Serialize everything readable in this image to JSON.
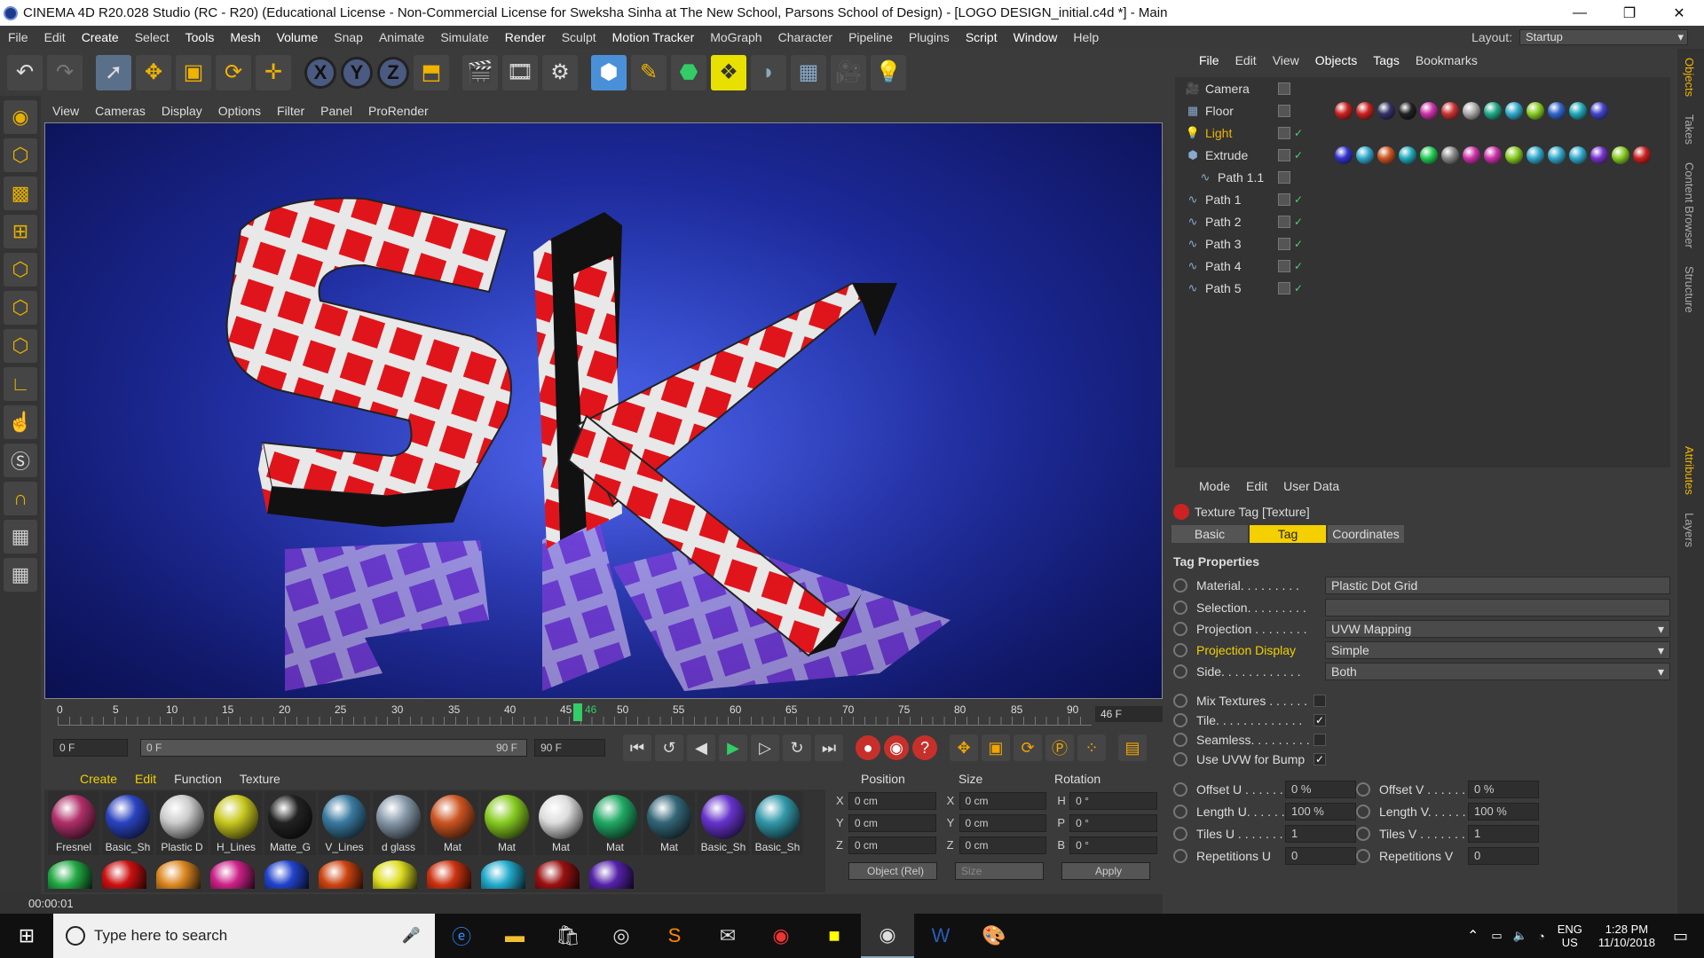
{
  "titlebar": {
    "title": "CINEMA 4D R20.028 Studio (RC - R20) (Educational License - Non-Commercial License for Sweksha Sinha at The New School, Parsons School of Design) - [LOGO DESIGN_initial.c4d *] - Main",
    "minimize": "—",
    "restore": "❐",
    "close": "✕"
  },
  "menubar": {
    "items": [
      "File",
      "Edit",
      "Create",
      "Select",
      "Tools",
      "Mesh",
      "Volume",
      "Snap",
      "Animate",
      "Simulate",
      "Render",
      "Sculpt",
      "Motion Tracker",
      "MoGraph",
      "Character",
      "Pipeline",
      "Plugins",
      "Script",
      "Window",
      "Help"
    ],
    "layout_label": "Layout:",
    "layout_value": "Startup"
  },
  "toolbar": {
    "icons": [
      "undo-icon",
      "redo-icon",
      "select-icon",
      "move-icon",
      "scale-icon",
      "rotate-icon",
      "add-icon",
      "x-axis-icon",
      "y-axis-icon",
      "z-axis-icon",
      "coord-icon",
      "render-view-icon",
      "render-icon",
      "render-settings-icon",
      "cube-icon",
      "pen-icon",
      "subdivision-icon",
      "array-icon",
      "deformer-icon",
      "floor-icon",
      "camera-icon",
      "light-icon"
    ],
    "x_label": "X",
    "y_label": "Y",
    "z_label": "Z"
  },
  "viewport": {
    "menu": [
      "View",
      "Cameras",
      "Display",
      "Options",
      "Filter",
      "Panel",
      "ProRender"
    ],
    "logo_text": "SK"
  },
  "timeline": {
    "ticks": [
      "0",
      "5",
      "10",
      "15",
      "20",
      "25",
      "30",
      "35",
      "40",
      "45",
      "46",
      "50",
      "55",
      "60",
      "65",
      "70",
      "75",
      "80",
      "85",
      "90"
    ],
    "current_frame": "46 F",
    "start_field": "0 F",
    "range_start": "0 F",
    "range_end": "90 F",
    "end_field": "90 F"
  },
  "materials": {
    "menu": [
      "Create",
      "Edit",
      "Function",
      "Texture"
    ],
    "items": [
      {
        "label": "Fresnel",
        "color": "#b0306a"
      },
      {
        "label": "Basic_Sh",
        "color": "#2a44c0"
      },
      {
        "label": "Plastic D",
        "color": "#cccccc"
      },
      {
        "label": "H_Lines",
        "color": "#c8c820"
      },
      {
        "label": "Matte_G",
        "color": "#222222"
      },
      {
        "label": "V_Lines",
        "color": "#3a7aa0"
      },
      {
        "label": "d glass",
        "color": "#8899aa"
      },
      {
        "label": "Mat",
        "color": "#cc5522"
      },
      {
        "label": "Mat",
        "color": "#88cc22"
      },
      {
        "label": "Mat",
        "color": "#dddddd"
      },
      {
        "label": "Mat",
        "color": "#22aa66"
      },
      {
        "label": "Mat",
        "color": "#336677"
      },
      {
        "label": "Basic_Sh",
        "color": "#6633cc"
      },
      {
        "label": "Basic_Sh",
        "color": "#3399aa"
      }
    ],
    "row2_colors": [
      "#22aa44",
      "#cc1111",
      "#dd8822",
      "#cc2288",
      "#2244cc",
      "#cc4411",
      "#dddd22",
      "#cc3311",
      "#22aacc",
      "#991111",
      "#5522aa"
    ]
  },
  "coordinates": {
    "headers": [
      "Position",
      "Size",
      "Rotation"
    ],
    "rows": [
      {
        "pos_axis": "X",
        "pos": "0 cm",
        "size_axis": "X",
        "size": "0 cm",
        "rot_axis": "H",
        "rot": "0 °"
      },
      {
        "pos_axis": "Y",
        "pos": "0 cm",
        "size_axis": "Y",
        "size": "0 cm",
        "rot_axis": "P",
        "rot": "0 °"
      },
      {
        "pos_axis": "Z",
        "pos": "0 cm",
        "size_axis": "Z",
        "size": "0 cm",
        "rot_axis": "B",
        "rot": "0 °"
      }
    ],
    "mode": "Object (Rel)",
    "size_mode": "Size",
    "apply": "Apply"
  },
  "status": "00:00:01",
  "objects": {
    "menu": [
      "File",
      "Edit",
      "View",
      "Objects",
      "Tags",
      "Bookmarks"
    ],
    "items": [
      {
        "name": "Camera",
        "icon": "camera-icon",
        "indent": 0,
        "highlight": false,
        "check": false
      },
      {
        "name": "Floor",
        "icon": "floor-icon",
        "indent": 0,
        "highlight": false,
        "check": false
      },
      {
        "name": "Light",
        "icon": "light-icon",
        "indent": 0,
        "highlight": true,
        "check": true
      },
      {
        "name": "Extrude",
        "icon": "extrude-icon",
        "indent": 0,
        "highlight": false,
        "check": true
      },
      {
        "name": "Path 1.1",
        "icon": "spline-icon",
        "indent": 1,
        "highlight": false,
        "check": false
      },
      {
        "name": "Path 1",
        "icon": "spline-icon",
        "indent": 0,
        "highlight": false,
        "check": true
      },
      {
        "name": "Path 2",
        "icon": "spline-icon",
        "indent": 0,
        "highlight": false,
        "check": true
      },
      {
        "name": "Path 3",
        "icon": "spline-icon",
        "indent": 0,
        "highlight": false,
        "check": true
      },
      {
        "name": "Path 4",
        "icon": "spline-icon",
        "indent": 0,
        "highlight": false,
        "check": true
      },
      {
        "name": "Path 5",
        "icon": "spline-icon",
        "indent": 0,
        "highlight": false,
        "check": true
      }
    ],
    "floor_tags": [
      "#c22",
      "#c22",
      "#336",
      "#222",
      "#c3a",
      "#c33",
      "#aaa",
      "#2a8",
      "#3ac",
      "#8c2",
      "#36c",
      "#2ab",
      "#44c"
    ],
    "extrude_tags": [
      "#33c",
      "#3ac",
      "#c52",
      "#2ab",
      "#2c5",
      "#888",
      "#c3a",
      "#c3a",
      "#8c2",
      "#3ac",
      "#3ac",
      "#3ac",
      "#73c",
      "#8c2",
      "#c22"
    ]
  },
  "attributes": {
    "menu": [
      "Mode",
      "Edit",
      "User Data"
    ],
    "title": "Texture Tag [Texture]",
    "tabs": [
      "Basic",
      "Tag",
      "Coordinates"
    ],
    "section": "Tag Properties",
    "material_label": "Material. . . . . . . . .",
    "material_value": "Plastic Dot Grid",
    "selection_label": "Selection. . . . . . . . .",
    "projection_label": "Projection . . . . . . . .",
    "projection_value": "UVW Mapping",
    "projection_display_label": "Projection Display",
    "projection_display_value": "Simple",
    "side_label": "Side. . . . . . . . . . . .",
    "side_value": "Both",
    "mix_label": "Mix Textures . . . . . .",
    "tile_label": "Tile. . . . . . . . . . . . .",
    "seamless_label": "Seamless. . . . . . . . .",
    "uvw_bump_label": "Use UVW for Bump",
    "offset_u_label": "Offset U . . . . . .",
    "offset_u": "0 %",
    "offset_v_label": "Offset V . . . . . .",
    "offset_v": "0 %",
    "length_u_label": "Length U. . . . . .",
    "length_u": "100 %",
    "length_v_label": "Length V. . . . . .",
    "length_v": "100 %",
    "tiles_u_label": "Tiles U . . . . . . .",
    "tiles_u": "1",
    "tiles_v_label": "Tiles V . . . . . . .",
    "tiles_v": "1",
    "rep_u_label": "Repetitions U",
    "rep_u": "0",
    "rep_v_label": "Repetitions V",
    "rep_v": "0",
    "check_mark": "✓"
  },
  "sidetabs": [
    "Objects",
    "Takes",
    "Content Browser",
    "Structure",
    "Attributes",
    "Layers"
  ],
  "taskbar": {
    "search_placeholder": "Type here to search",
    "lang": "ENG",
    "region": "US",
    "time": "1:28 PM",
    "date": "11/10/2018"
  }
}
